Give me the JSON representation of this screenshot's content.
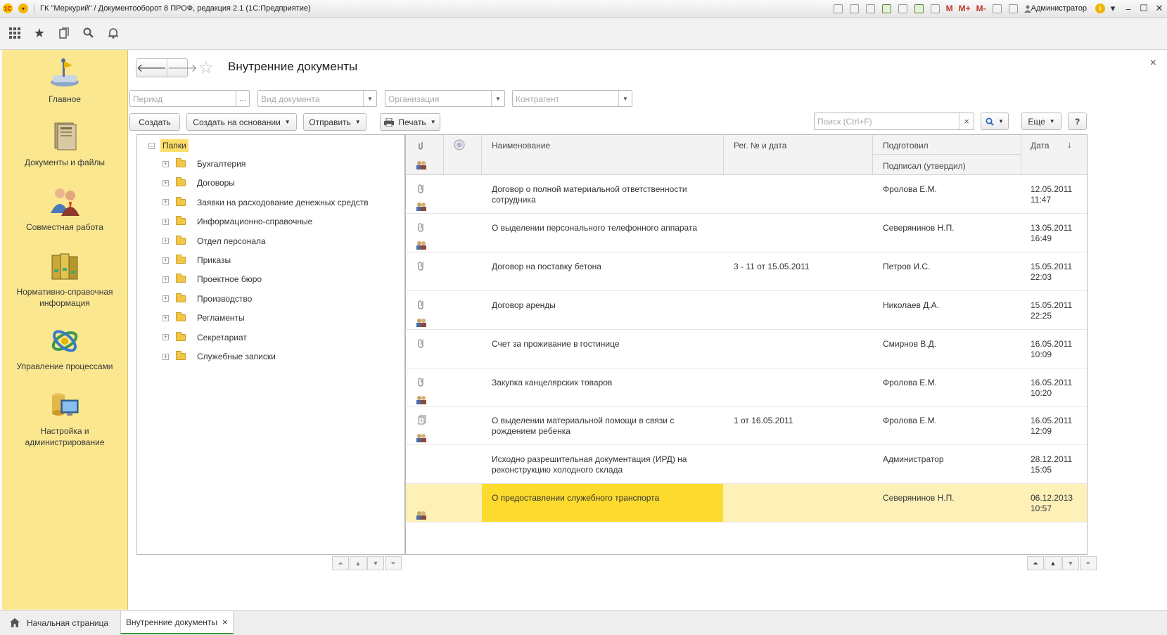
{
  "titlebar": {
    "title": "ГК \"Меркурий\" / Документооборот 8 ПРОФ, редакция 2.1  (1С:Предприятие)",
    "user": "Администратор",
    "mem_labels": [
      "M",
      "M+",
      "M-"
    ]
  },
  "sections": [
    {
      "label": "Главное",
      "icon": "main-section-icon"
    },
    {
      "label": "Документы и файлы",
      "icon": "documents-icon"
    },
    {
      "label": "Совместная работа",
      "icon": "collaboration-icon"
    },
    {
      "label": "Нормативно-справочная информация",
      "icon": "reference-books-icon"
    },
    {
      "label": "Управление процессами",
      "icon": "processes-icon"
    },
    {
      "label": "Настройка и администрирование",
      "icon": "settings-computer-icon"
    }
  ],
  "page": {
    "title": "Внутренние документы",
    "close_label": "×"
  },
  "filters": {
    "period_placeholder": "Период",
    "period_btn": "...",
    "doc_type_placeholder": "Вид документа",
    "org_placeholder": "Организация",
    "contractor_placeholder": "Контрагент"
  },
  "toolbar": {
    "create": "Создать",
    "create_based": "Создать на основании",
    "send": "Отправить",
    "print": "Печать",
    "search_placeholder": "Поиск (Ctrl+F)",
    "more": "Еще",
    "help": "?"
  },
  "tree": {
    "root": "Папки",
    "folders": [
      "Бухгалтерия",
      "Договоры",
      "Заявки на расходование денежных средств",
      "Информационно-справочные",
      "Отдел персонала",
      "Приказы",
      "Проектное бюро",
      "Производство",
      "Регламенты",
      "Секретариат",
      "Служебные записки"
    ]
  },
  "table": {
    "headers": {
      "name": "Наименование",
      "reg": "Рег. № и дата",
      "prepared": "Подготовил",
      "signed": "Подписал (утвердил)",
      "date": "Дата",
      "sort_icon": "↓"
    },
    "rows": [
      {
        "name": "Договор о полной материальной ответственности сотрудника",
        "reg": "",
        "prepared": "Фролова Е.М.",
        "date": "12.05.2011",
        "time": "11:47",
        "clip": "paperclip",
        "users": true
      },
      {
        "name": "О выделении персонального телефонного аппарата",
        "reg": "",
        "prepared": "Северянинов Н.П.",
        "date": "13.05.2011",
        "time": "16:49",
        "clip": "paperclip",
        "users": true
      },
      {
        "name": "Договор на поставку бетона",
        "reg": "3 - 11 от 15.05.2011",
        "prepared": "Петров И.С.",
        "date": "15.05.2011",
        "time": "22:03",
        "clip": "paperclip",
        "users": false
      },
      {
        "name": "Договор аренды",
        "reg": "",
        "prepared": "Николаев Д.А.",
        "date": "15.05.2011",
        "time": "22:25",
        "clip": "paperclip",
        "users": true
      },
      {
        "name": "Счет за проживание в гостинице",
        "reg": "",
        "prepared": "Смирнов В.Д.",
        "date": "16.05.2011",
        "time": "10:09",
        "clip": "paperclip",
        "users": false
      },
      {
        "name": "Закупка канцелярских товаров",
        "reg": "",
        "prepared": "Фролова Е.М.",
        "date": "16.05.2011",
        "time": "10:20",
        "clip": "paperclip",
        "users": true
      },
      {
        "name": "О выделении материальной помощи в связи с рождением ребенка",
        "reg": "1 от 16.05.2011",
        "prepared": "Фролова Е.М.",
        "date": "16.05.2011",
        "time": "12:09",
        "clip": "stack",
        "users": true
      },
      {
        "name": "Исходно разрешительная документация (ИРД) на реконструкцию холодного склада",
        "reg": "",
        "prepared": "Администратор",
        "date": "28.12.2011",
        "time": "15:05",
        "clip": "none",
        "users": false
      },
      {
        "name": "О предоставлении служебного транспорта",
        "reg": "",
        "prepared": "Северянинов Н.П.",
        "date": "06.12.2013",
        "time": "10:57",
        "clip": "none",
        "users": true,
        "selected": true
      }
    ]
  },
  "bottom_tabs": {
    "home": "Начальная страница",
    "current": "Внутренние документы",
    "close": "×"
  },
  "colors": {
    "sections_bg": "#fbe790",
    "selection": "#fddb2e",
    "selected_row": "#fdf1b8"
  }
}
